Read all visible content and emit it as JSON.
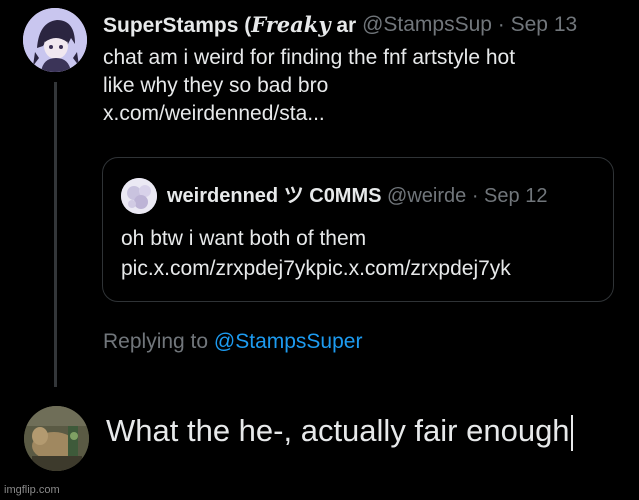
{
  "tweet": {
    "display_name": "SuperStamps (",
    "display_name_fancy": "Freaky",
    "display_name_tail": " ar",
    "handle": "@StampsSup",
    "separator": " · ",
    "date": "Sep 13",
    "text_lines": [
      "chat am i weird for finding the fnf artstyle hot",
      "like why they so bad bro",
      "x.com/weirdenned/sta..."
    ]
  },
  "quote": {
    "display_name": "weirdenned ツ C0MMS",
    "handle": "@weirde",
    "separator": " · ",
    "date": "Sep 12",
    "text_lines": [
      "oh btw i want both of them",
      "pic.x.com/zrxpdej7ykpic.x.com/zrxpdej7yk"
    ]
  },
  "replying": {
    "prefix": "Replying to",
    "mention": "@StampsSuper"
  },
  "reply": {
    "value": "What the he-, actually fair enough"
  },
  "watermark": "imgflip.com",
  "colors": {
    "background": "#000000",
    "text": "#e7e9ea",
    "muted": "#71767b",
    "link": "#1d9bf0",
    "border": "#2f3336"
  }
}
